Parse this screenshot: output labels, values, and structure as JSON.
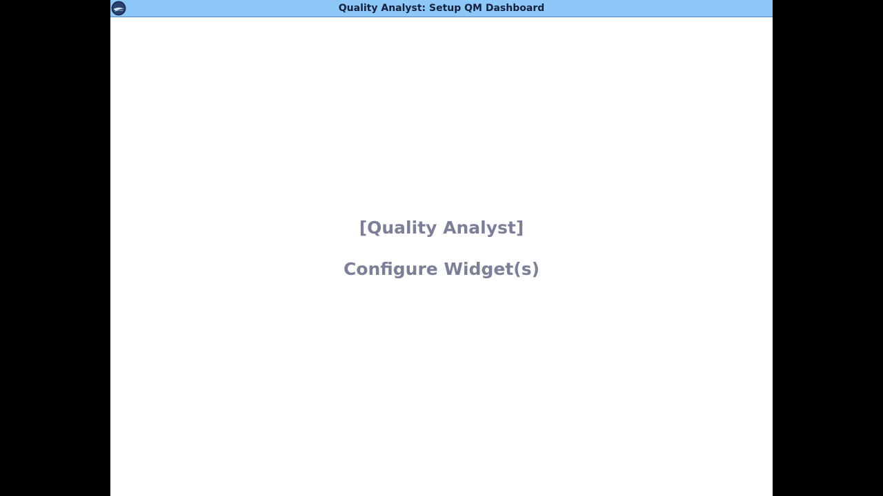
{
  "window": {
    "title": "Quality Analyst: Setup QM Dashboard",
    "icon": "app-logo-icon"
  },
  "slide": {
    "line1": "[Quality Analyst]",
    "line2": "Configure Widget(s)"
  },
  "colors": {
    "titlebar": "#8ec8f8",
    "heading_text": "#7b7f98",
    "title_text": "#14213d"
  }
}
